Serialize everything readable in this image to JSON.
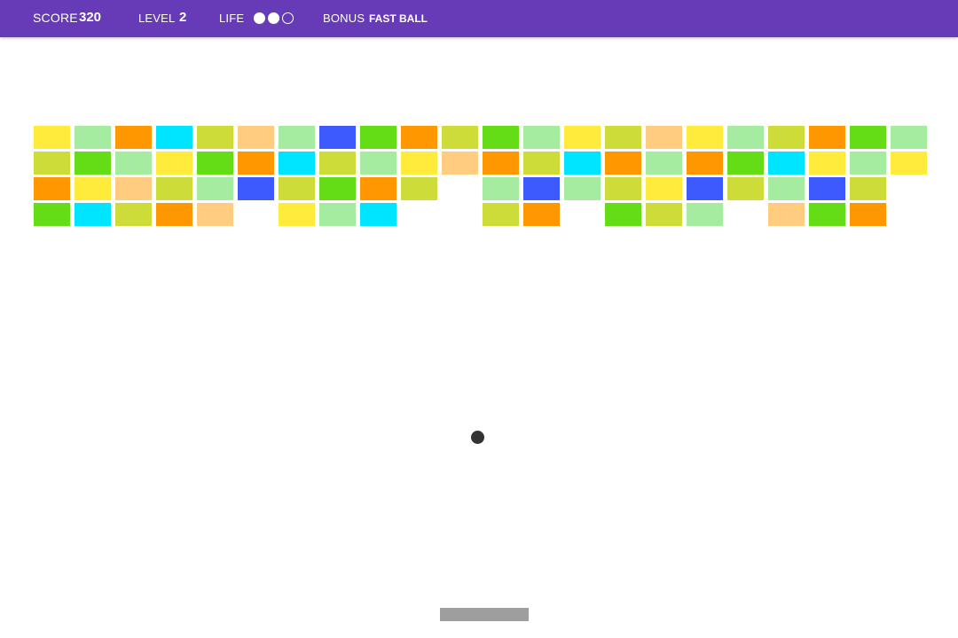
{
  "hud": {
    "score_label": "SCORE",
    "score_value": "320",
    "level_label": "LEVEL",
    "level_value": "2",
    "life_label": "LIFE",
    "lives_total": 3,
    "lives_remaining": 2,
    "bonus_label": "BONUS",
    "bonus_value": "FAST BALL"
  },
  "colors": {
    "header": "#673ab7",
    "ball": "#333333",
    "paddle": "#9e9e9e",
    "Y": "#ffeb3b",
    "M": "#a5eba0",
    "O": "#ff9800",
    "C": "#00e5ff",
    "L": "#cddc39",
    "P": "#ffcc80",
    "B": "#3d5afe",
    "G": "#64dd17"
  },
  "bricks": {
    "columns": 22,
    "rows": [
      "YMOCLPMBGOLGMYLPYMLOGM",
      "LGMYGOCLMYPOLCOMOGCYMY",
      "OYPLMBLGOL.MBMLYBLMBL.",
      "GCLOP.YMC..LO.GLM.PGO."
    ]
  }
}
